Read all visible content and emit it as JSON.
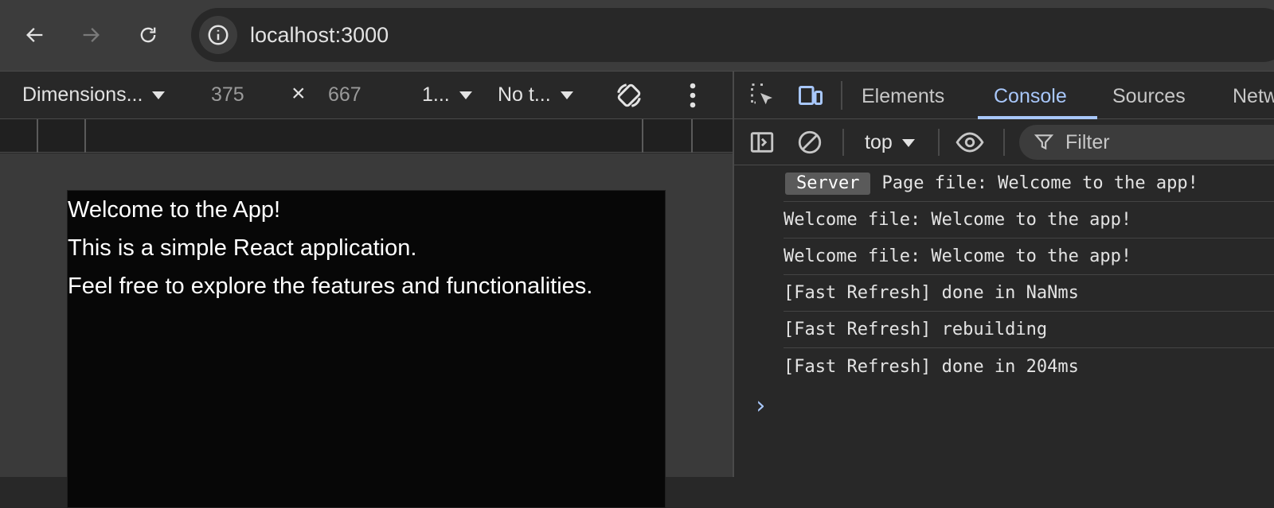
{
  "browser": {
    "url": "localhost:3000"
  },
  "device_toolbar": {
    "dimensions_label": "Dimensions...",
    "width": "375",
    "times": "×",
    "height": "667",
    "zoom_label": "1...",
    "throttle_label": "No t..."
  },
  "page": {
    "lines": [
      "Welcome to the App!",
      "This is a simple React application.",
      "Feel free to explore the features and functionalities."
    ]
  },
  "devtools": {
    "tabs": [
      "Elements",
      "Console",
      "Sources",
      "Netw"
    ],
    "active_tab": "Console",
    "context": "top",
    "filter_placeholder": "Filter",
    "console_rows": [
      {
        "badge": "Server",
        "text": "Page file: Welcome to the app!"
      },
      {
        "text": "Welcome file: Welcome to the app!"
      },
      {
        "text": "Welcome file: Welcome to the app!"
      },
      {
        "text": "[Fast Refresh] done in NaNms"
      },
      {
        "text": "[Fast Refresh] rebuilding"
      },
      {
        "text": "[Fast Refresh] done in 204ms"
      }
    ],
    "prompt": "›"
  },
  "colors": {
    "accent": "#a8c7fa",
    "background": "#282828"
  }
}
